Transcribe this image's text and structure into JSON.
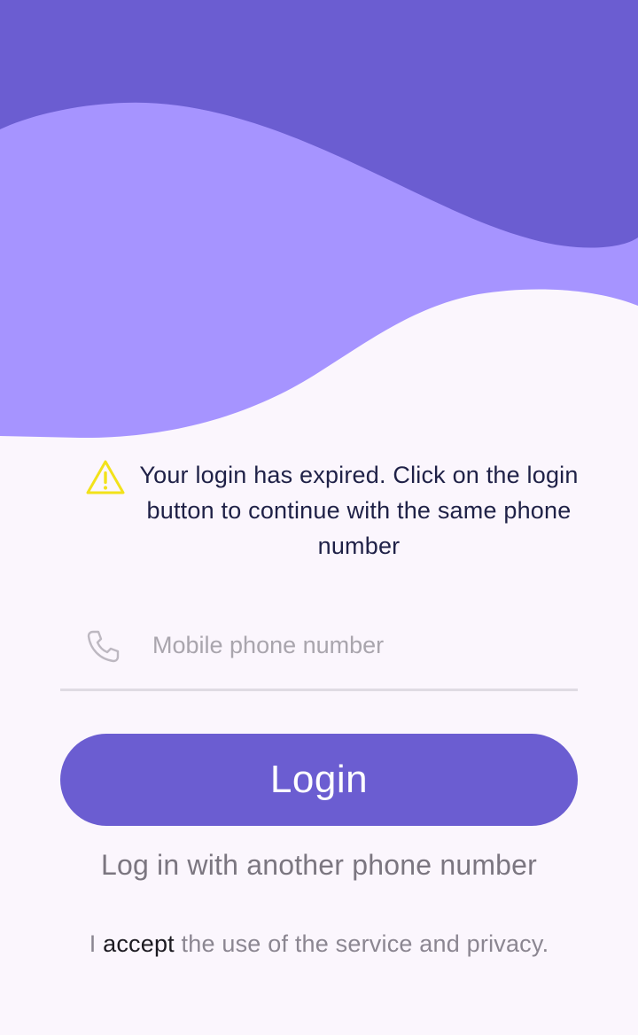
{
  "colors": {
    "background": "#fbf6fd",
    "wave_dark": "#6b5dd1",
    "wave_light": "#a694ff",
    "warning": "#f2e21a",
    "button": "#6b5dd1"
  },
  "icons": {
    "notice": "warning-triangle-icon",
    "phone_field": "phone-icon"
  },
  "notice": {
    "message": "Your login has expired. Click on the login button to continue with the same phone number"
  },
  "phone_field": {
    "value": "",
    "placeholder": "Mobile phone number"
  },
  "login_button": {
    "label": "Login"
  },
  "alt_login": {
    "label": "Log in with another phone number"
  },
  "terms": {
    "prefix": "I ",
    "accept_link": "accept",
    "suffix": " the use of the service and privacy."
  }
}
